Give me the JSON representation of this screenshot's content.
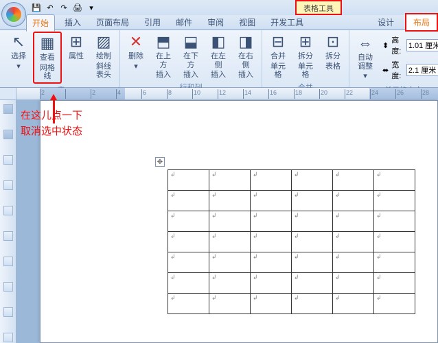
{
  "qat_icons": {
    "save": "💾",
    "undo": "↶",
    "redo": "↷",
    "print": "🖨",
    "more": "▾"
  },
  "context_tool": {
    "title": "表格工具",
    "design": "设计",
    "layout": "布局"
  },
  "tabs": {
    "home": "开始",
    "insert": "插入",
    "pagelayout": "页面布局",
    "references": "引用",
    "mailings": "邮件",
    "review": "审阅",
    "view": "视图",
    "developer": "开发工具"
  },
  "ribbon": {
    "select": {
      "label": "选择",
      "icon": "▭"
    },
    "gridlines": {
      "label1": "查看",
      "label2": "网格线",
      "icon": "▦"
    },
    "properties": {
      "label": "属性",
      "icon": "⊞"
    },
    "drawdiag": {
      "label1": "绘制",
      "label2": "斜线表头",
      "icon": "▨"
    },
    "group_table": "表",
    "delete": {
      "label": "删除",
      "icon": "✕"
    },
    "ins_above": {
      "label1": "在上方",
      "label2": "插入",
      "icon": "⬒"
    },
    "ins_below": {
      "label1": "在下方",
      "label2": "插入",
      "icon": "⬓"
    },
    "ins_left": {
      "label1": "在左侧",
      "label2": "插入",
      "icon": "◧"
    },
    "ins_right": {
      "label1": "在右侧",
      "label2": "插入",
      "icon": "◨"
    },
    "group_rowscols": "行和列",
    "merge": {
      "label1": "合并",
      "label2": "单元格",
      "icon": "⊟"
    },
    "split": {
      "label1": "拆分",
      "label2": "单元格",
      "icon": "⊞"
    },
    "splittbl": {
      "label1": "拆分",
      "label2": "表格",
      "icon": "⊡"
    },
    "group_merge": "合并",
    "autofit": {
      "label1": "自动调整",
      "icon": "⇔"
    },
    "height": {
      "label": "高度:",
      "value": "1.01 厘米",
      "icon": "⬍"
    },
    "width": {
      "label": "宽度:",
      "value": "2.1 厘米",
      "icon": "⬌"
    },
    "group_size": "单元格大小"
  },
  "ruler_ticks": [
    "2",
    "",
    "2",
    "4",
    "6",
    "8",
    "10",
    "12",
    "14",
    "16",
    "18",
    "20",
    "22",
    "24",
    "26",
    "28"
  ],
  "annotation": {
    "l1": "在这儿点一下",
    "l2": "取消选中状态"
  },
  "cellmark": "↲",
  "movehandle": "✥"
}
